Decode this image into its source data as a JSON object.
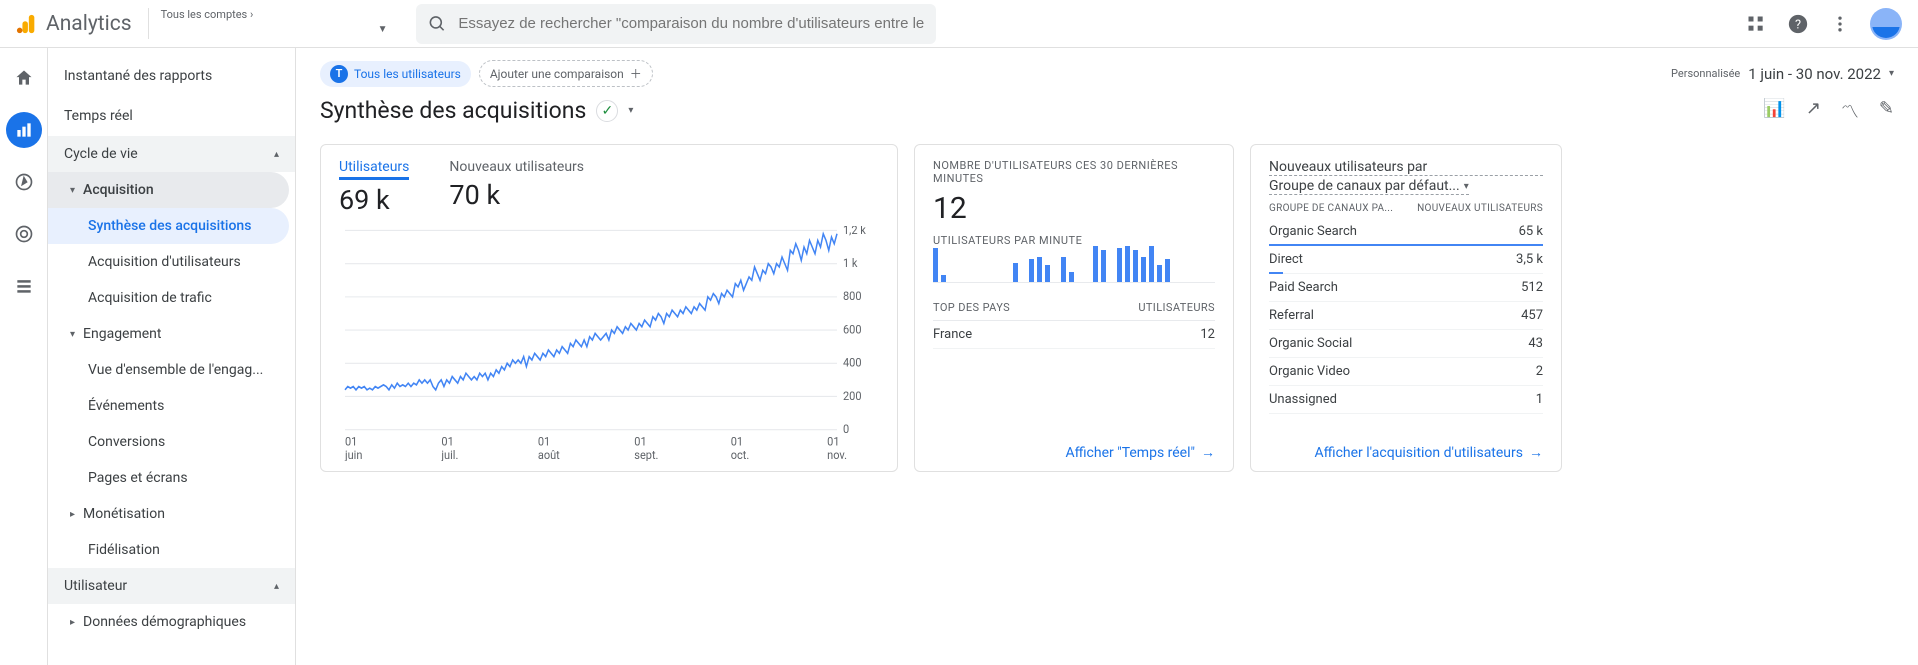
{
  "header": {
    "product": "Analytics",
    "account_line1": "Tous les comptes ›",
    "account_line2": "",
    "search_placeholder": "Essayez de rechercher \"comparaison du nombre d'utilisateurs entre le mo..."
  },
  "sidebar": {
    "top": [
      {
        "label": "Instantané des rapports"
      },
      {
        "label": "Temps réel"
      }
    ],
    "section_life": "Cycle de vie",
    "acquisition": {
      "label": "Acquisition",
      "items": [
        "Synthèse des acquisitions",
        "Acquisition d'utilisateurs",
        "Acquisition de trafic"
      ]
    },
    "engagement": {
      "label": "Engagement",
      "items": [
        "Vue d'ensemble de l'engag...",
        "Événements",
        "Conversions",
        "Pages et écrans"
      ]
    },
    "monetisation": "Monétisation",
    "fidelisation": "Fidélisation",
    "section_user": "Utilisateur",
    "demographics": "Données démographiques"
  },
  "top_bar": {
    "chip_all": "Tous les utilisateurs",
    "chip_badge": "T",
    "chip_add": "Ajouter une comparaison",
    "date_label": "Personnalisée",
    "date_value": "1 juin - 30 nov. 2022"
  },
  "page": {
    "title": "Synthèse des acquisitions"
  },
  "card_chart": {
    "metric1_label": "Utilisateurs",
    "metric1_value": "69 k",
    "metric2_label": "Nouveaux utilisateurs",
    "metric2_value": "70 k",
    "footer": ""
  },
  "chart_data": {
    "type": "line",
    "x_ticks": [
      "01 juin",
      "01 juil.",
      "01 août",
      "01 sept.",
      "01 oct.",
      "01 nov."
    ],
    "y_ticks": [
      0,
      200,
      400,
      600,
      800,
      1000,
      1200
    ],
    "y_tick_labels": [
      "0",
      "200",
      "400",
      "600",
      "800",
      "1 k",
      "1,2 k"
    ],
    "ylabel": "",
    "xlabel": "",
    "series": [
      {
        "name": "Utilisateurs",
        "values": [
          240,
          260,
          250,
          260,
          240,
          260,
          250,
          260,
          240,
          250,
          240,
          260,
          250,
          260,
          270,
          260,
          240,
          270,
          250,
          280,
          260,
          270,
          260,
          280,
          260,
          280,
          270,
          300,
          280,
          300,
          280,
          300,
          260,
          240,
          280,
          300,
          260,
          300,
          280,
          320,
          300,
          280,
          320,
          300,
          340,
          320,
          300,
          320,
          300,
          340,
          320,
          340,
          300,
          340,
          320,
          360,
          340,
          380,
          360,
          400,
          380,
          420,
          400,
          420,
          400,
          440,
          380,
          440,
          420,
          460,
          440,
          420,
          460,
          440,
          480,
          460,
          440,
          480,
          460,
          500,
          480,
          460,
          520,
          500,
          540,
          520,
          500,
          540,
          500,
          560,
          540,
          580,
          560,
          540,
          560,
          580,
          540,
          600,
          580,
          620,
          600,
          580,
          620,
          600,
          640,
          620,
          600,
          640,
          620,
          660,
          640,
          620,
          680,
          660,
          700,
          680,
          640,
          700,
          680,
          720,
          700,
          680,
          720,
          700,
          740,
          720,
          700,
          740,
          720,
          760,
          740,
          720,
          800,
          780,
          820,
          800,
          760,
          820,
          800,
          840,
          820,
          800,
          880,
          860,
          900,
          840,
          880,
          920,
          900,
          980,
          940,
          900,
          960,
          940,
          1000,
          980,
          940,
          1000,
          980,
          1040,
          1000,
          960,
          1080,
          1060,
          1120,
          1080,
          1020,
          1100,
          1060,
          1140,
          1100,
          1060,
          1140,
          1100,
          1180,
          1140,
          1080,
          1160,
          1120,
          1180
        ]
      }
    ]
  },
  "card_rt": {
    "header": "NOMBRE D'UTILISATEURS CES 30 DERNIÈRES MINUTES",
    "value": "12",
    "sub_header": "UTILISATEURS PAR MINUTE",
    "bars": [
      28,
      3,
      0,
      0,
      0,
      0,
      0,
      0,
      0,
      0,
      14,
      0,
      18,
      20,
      12,
      0,
      20,
      6,
      0,
      0,
      30,
      26,
      0,
      28,
      30,
      26,
      20,
      30,
      12,
      18
    ],
    "cols": {
      "left": "TOP DES PAYS",
      "right": "UTILISATEURS"
    },
    "rows": [
      {
        "name": "France",
        "value": "12"
      }
    ],
    "footer": "Afficher \"Temps réel\""
  },
  "card_acq": {
    "pre": "Nouveaux utilisateurs par",
    "dimension": "Groupe de canaux par défaut...",
    "cols": {
      "left": "GROUPE DE CANAUX PA...",
      "right": "NOUVEAUX UTILISATEURS"
    },
    "rows": [
      {
        "name": "Organic Search",
        "value": "65 k"
      },
      {
        "name": "Direct",
        "value": "3,5 k"
      },
      {
        "name": "Paid Search",
        "value": "512"
      },
      {
        "name": "Referral",
        "value": "457"
      },
      {
        "name": "Organic Social",
        "value": "43"
      },
      {
        "name": "Organic Video",
        "value": "2"
      },
      {
        "name": "Unassigned",
        "value": "1"
      }
    ],
    "footer": "Afficher l'acquisition d'utilisateurs"
  }
}
